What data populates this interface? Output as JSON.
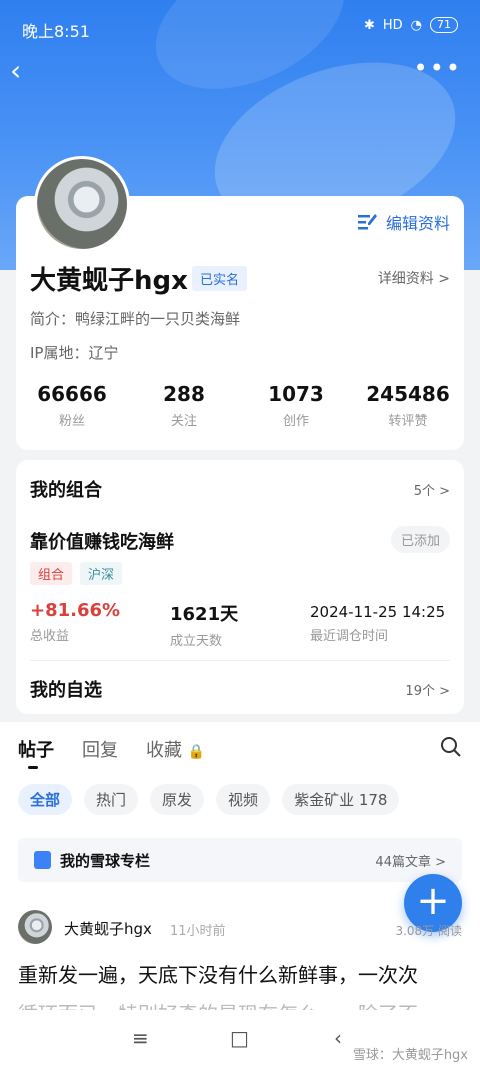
{
  "status": {
    "time": "晚上8:51",
    "signal": "HD",
    "battery": "71"
  },
  "profile": {
    "edit_label": "编辑资料",
    "name": "大黄蚬子hgx",
    "verified": "已实名",
    "detail_label": "详细资料 >",
    "bio": "简介：鸭绿江畔的一只贝类海鲜",
    "ip": "IP属地：辽宁",
    "stats": [
      {
        "value": "66666",
        "label": "粉丝"
      },
      {
        "value": "288",
        "label": "关注"
      },
      {
        "value": "1073",
        "label": "创作"
      },
      {
        "value": "245486",
        "label": "转评赞"
      }
    ]
  },
  "portfolio": {
    "title": "我的组合",
    "count": "5个 >",
    "item_name": "靠价值赚钱吃海鲜",
    "added": "已添加",
    "tags": [
      "组合",
      "沪深"
    ],
    "total_return": {
      "value": "+81.66%",
      "label": "总收益"
    },
    "days": {
      "value": "1621天",
      "label": "成立天数"
    },
    "last_rebalance": {
      "value": "2024-11-25 14:25",
      "label": "最近调仓时间"
    },
    "watchlist_title": "我的自选",
    "watchlist_count": "19个 >"
  },
  "tabs": [
    "帖子",
    "回复",
    "收藏"
  ],
  "chips": [
    "全部",
    "热门",
    "原发",
    "视频",
    "紫金矿业 178"
  ],
  "column": {
    "title": "我的雪球专栏",
    "count": "44篇文章 >"
  },
  "post": {
    "author": "大黄蚬子hgx",
    "time": "11小时前",
    "reads": "3.08万 阅读",
    "text": "重新发一遍，天底下没有什么新鲜事，一次次",
    "text2": "循环而已。特别好奇的是现在怎么……除了不"
  },
  "watermark": "雪球：大黄蚬子hgx"
}
